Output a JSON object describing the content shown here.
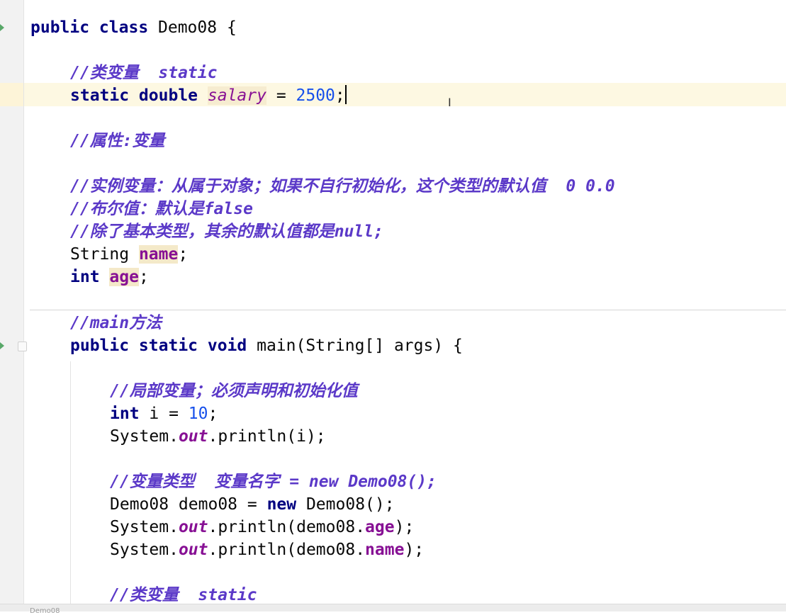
{
  "editor": {
    "file_tab": "Demo08",
    "lines": {
      "l1_kw": "public class",
      "l1_rest": " Demo08 {",
      "l2_comment": "//类变量  static",
      "l3_kw": "static double",
      "l3_field": "salary",
      "l3_eq": " = ",
      "l3_num": "2500",
      "l3_end": ";",
      "l4_comment": "//属性:变量",
      "l5_comment": "//实例变量：从属于对象；如果不自行初始化，这个类型的默认值  0 0.0",
      "l6_comment": "//布尔值：默认是false",
      "l7_comment": "//除了基本类型，其余的默认值都是null;",
      "l8_type": "String ",
      "l8_field": "name",
      "l8_end": ";",
      "l9_kw": "int",
      "l9_field": "age",
      "l9_end": ";",
      "l10_comment": "//main方法",
      "l11_kw": "public static void",
      "l11_rest": " main(String[] args) {",
      "l12_comment": "//局部变量；必须声明和初始化值",
      "l13_kw": "int",
      "l13_mid": " i = ",
      "l13_num": "10",
      "l13_end": ";",
      "l14_a": "System.",
      "l14_out": "out",
      "l14_b": ".println(i);",
      "l15_comment": "//变量类型  变量名字 = new Demo08();",
      "l16_a": "Demo08 demo08 = ",
      "l16_kw": "new",
      "l16_b": " Demo08();",
      "l17_a": "System.",
      "l17_out": "out",
      "l17_b": ".println(demo08.",
      "l17_field": "age",
      "l17_c": ");",
      "l18_a": "System.",
      "l18_out": "out",
      "l18_b": ".println(demo08.",
      "l18_field": "name",
      "l18_c": ");",
      "l19_comment": "//类变量  static"
    }
  },
  "colors": {
    "keyword": "#000080",
    "comment": "#5b39c8",
    "number": "#1750eb",
    "field": "#871094",
    "current_line": "#fdf8e2"
  }
}
